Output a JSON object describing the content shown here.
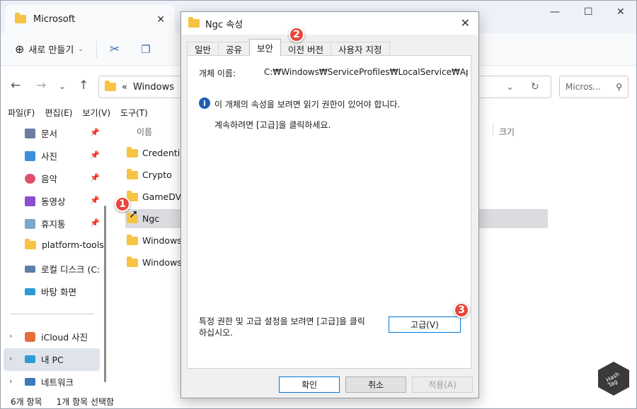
{
  "window": {
    "tab_title": "Microsoft"
  },
  "toolbar": {
    "new_label": "새로 만들기"
  },
  "address": {
    "chevrons": "«",
    "path": "Windows"
  },
  "search": {
    "placeholder": "Micros..."
  },
  "menu": [
    "파일(F)",
    "편집(E)",
    "보기(V)",
    "도구(T)"
  ],
  "sidebar": {
    "quick": [
      {
        "label": "문서",
        "icon": "document-icon",
        "color": "#6b7da3"
      },
      {
        "label": "사진",
        "icon": "picture-icon",
        "color": "#3a8fd9"
      },
      {
        "label": "음악",
        "icon": "music-icon",
        "color": "#e0506e"
      },
      {
        "label": "동영상",
        "icon": "video-icon",
        "color": "#8a4fd0"
      },
      {
        "label": "휴지통",
        "icon": "recycle-bin-icon",
        "color": "#7fa7c9"
      },
      {
        "label": "platform-tools",
        "icon": "folder-icon",
        "color": "#f6c343"
      },
      {
        "label": "로컬 디스크 (C:",
        "icon": "drive-icon",
        "color": "#5a7fa8"
      },
      {
        "label": "바탕 화면",
        "icon": "desktop-icon",
        "color": "#2e9bd6"
      }
    ],
    "tree": [
      {
        "label": "iCloud 사진",
        "icon": "icloud-photos-icon",
        "color": "#e46f3b"
      },
      {
        "label": "내 PC",
        "icon": "pc-icon",
        "color": "#2e9bd6"
      },
      {
        "label": "네트워크",
        "icon": "network-icon",
        "color": "#3a7bbd"
      }
    ]
  },
  "files": {
    "header_name": "이름",
    "header_size": "크기",
    "items": [
      "Credentials",
      "Crypto",
      "GameDVR",
      "Ngc",
      "Windows",
      "WindowsA"
    ]
  },
  "status": {
    "count": "6개 항목",
    "selected": "1개 항목 선택함"
  },
  "dialog": {
    "title": "Ngc 속성",
    "tabs": [
      "일반",
      "공유",
      "보안",
      "이전 버전",
      "사용자 지정"
    ],
    "object_label": "개체 이름:",
    "object_value": "C:₩Windows₩ServiceProfiles₩LocalService₩AppDat",
    "info_text": "이 개체의 속성을 보려면 읽기 권한이 있어야 합니다.",
    "continue_text": "계속하려면 [고급]을 클릭하세요.",
    "advanced_hint_1": "특정 권한 및 고급 설정을 보려면 [고급]을 클릭",
    "advanced_hint_2": "하십시오.",
    "advanced_button": "고급(V)",
    "ok": "확인",
    "cancel": "취소",
    "apply": "적용(A)"
  },
  "badges": [
    "1",
    "2",
    "3"
  ],
  "logo_text": "Hash Tag"
}
